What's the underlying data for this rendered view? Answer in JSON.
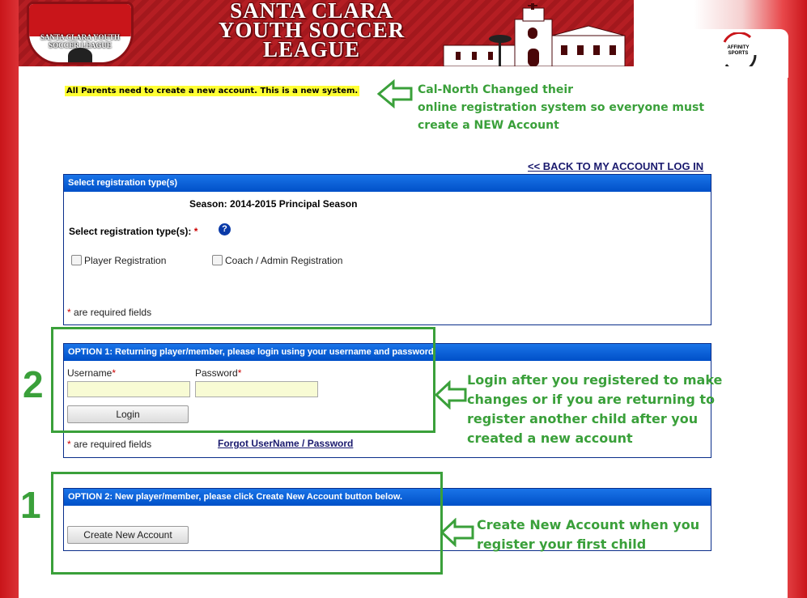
{
  "header": {
    "crest_text": "SANTA CLARA YOUTH SOCCER LEAGUE",
    "title_line1": "SANTA CLARA",
    "title_line2": "YOUTH SOCCER",
    "title_line3": "LEAGUE",
    "affinity_logo": "AFFINITY SPORTS"
  },
  "notice": "All Parents need to create a new account. This is a new system.",
  "annotations": {
    "top": [
      "Cal-North Changed their",
      "online registration system so everyone must",
      "create a NEW Account"
    ],
    "middle": [
      "Login after you registered to make",
      "changes or if you are returning to",
      "register another child after you",
      "created a new account"
    ],
    "bottom": [
      "Create New Account when you",
      "register your first child"
    ],
    "num_option1": "2",
    "num_option2": "1"
  },
  "back_link": "<< BACK TO MY ACCOUNT LOG IN",
  "registration": {
    "header": "Select registration type(s)",
    "season": "Season: 2014-2015 Principal Season",
    "label": "Select registration type(s):",
    "required_star": "*",
    "help_glyph": "?",
    "options": [
      "Player Registration",
      "Coach / Admin Registration"
    ],
    "required_note": "are required fields"
  },
  "option1": {
    "header": "OPTION 1:  Returning player/member, please login using your username and password.",
    "username_label": "Username",
    "password_label": "Password",
    "login_button": "Login",
    "required_note": "are required fields",
    "forgot_link": "Forgot UserName / Password"
  },
  "option2": {
    "header": "OPTION 2:  New player/member, please click Create New Account button below.",
    "create_button": "Create New Account"
  },
  "colors": {
    "banner_red": "#b51e23",
    "panel_blue": "#0b5ed7",
    "annotation_green": "#3aa03a",
    "highlight_yellow": "#ffff33"
  }
}
